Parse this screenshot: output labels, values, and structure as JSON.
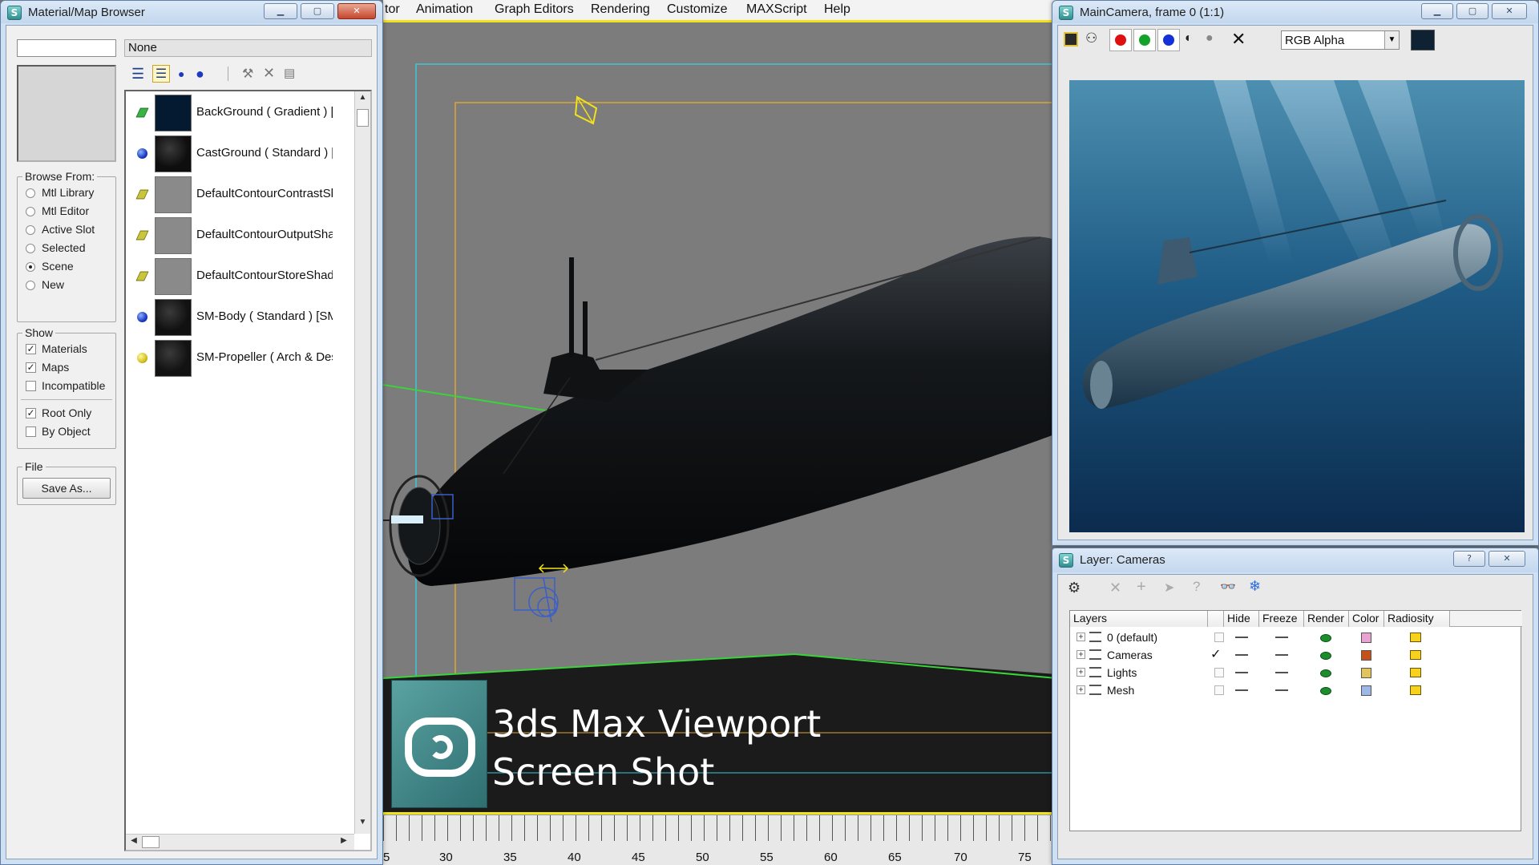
{
  "main_menu": [
    "tor",
    "Animation",
    "Graph Editors",
    "Rendering",
    "Customize",
    "MAXScript",
    "Help"
  ],
  "material_browser": {
    "title": "Material/Map Browser",
    "name_field_value": "None",
    "browse_from": {
      "label": "Browse From:",
      "options": [
        "Mtl Library",
        "Mtl Editor",
        "Active Slot",
        "Selected",
        "Scene",
        "New"
      ],
      "selected": "Scene"
    },
    "show": {
      "label": "Show",
      "items": [
        {
          "label": "Materials",
          "checked": true
        },
        {
          "label": "Maps",
          "checked": true
        },
        {
          "label": "Incompatible",
          "checked": false
        },
        {
          "label": "Root Only",
          "checked": true
        },
        {
          "label": "By Object",
          "checked": false
        }
      ]
    },
    "file": {
      "label": "File",
      "save_as": "Save As..."
    },
    "materials": [
      {
        "name": "BackGround  ( Gradient )  [Environment]",
        "kind": "map",
        "marker_color": "#38b445",
        "thumb": "#041a30"
      },
      {
        "name": "CastGround  ( Standard )  [CastGround]",
        "kind": "material",
        "marker_color": "#1d3ac0",
        "thumb": "#0e0e0e"
      },
      {
        "name": "DefaultContourContrastShader",
        "kind": "map",
        "marker_color": "#c9c63d",
        "thumb": "#8a8a8a"
      },
      {
        "name": "DefaultContourOutputShader",
        "kind": "map",
        "marker_color": "#c9c63d",
        "thumb": "#8a8a8a"
      },
      {
        "name": "DefaultContourStoreShader",
        "kind": "map",
        "marker_color": "#c9c63d",
        "thumb": "#8a8a8a"
      },
      {
        "name": "SM-Body  ( Standard )  [SM-Body]",
        "kind": "material",
        "marker_color": "#1d3ac0",
        "thumb": "#111111"
      },
      {
        "name": "SM-Propeller  ( Arch & Design )",
        "kind": "material",
        "marker_color": "#d4c21a",
        "thumb": "#121212"
      }
    ]
  },
  "viewport": {
    "overlay_title_line1": "3ds Max Viewport",
    "overlay_title_line2": "Screen Shot",
    "ruler_ticks": [
      "5",
      "30",
      "35",
      "40",
      "45",
      "50",
      "55",
      "60",
      "65",
      "70",
      "75"
    ]
  },
  "render_window": {
    "title": "MainCamera, frame 0 (1:1)",
    "channel_select": "RGB Alpha",
    "swatch_color": "#0f2233"
  },
  "layer_manager": {
    "title": "Layer: Cameras",
    "help": "?",
    "columns": [
      "Layers",
      "Hide",
      "Freeze",
      "Render",
      "Color",
      "Radiosity"
    ],
    "layers": [
      {
        "name": "0 (default)",
        "current": false,
        "color": "#e9a3d3"
      },
      {
        "name": "Cameras",
        "current": true,
        "color": "#c4501a"
      },
      {
        "name": "Lights",
        "current": false,
        "color": "#e2c45a"
      },
      {
        "name": "Mesh",
        "current": false,
        "color": "#9cb8e6"
      }
    ]
  },
  "accent": {
    "viewport_background": "#7c7c7c",
    "selection_yellow": "#f2e21b",
    "grid_green": "#3ad33a",
    "frame_cyan": "#3cc8d8"
  }
}
